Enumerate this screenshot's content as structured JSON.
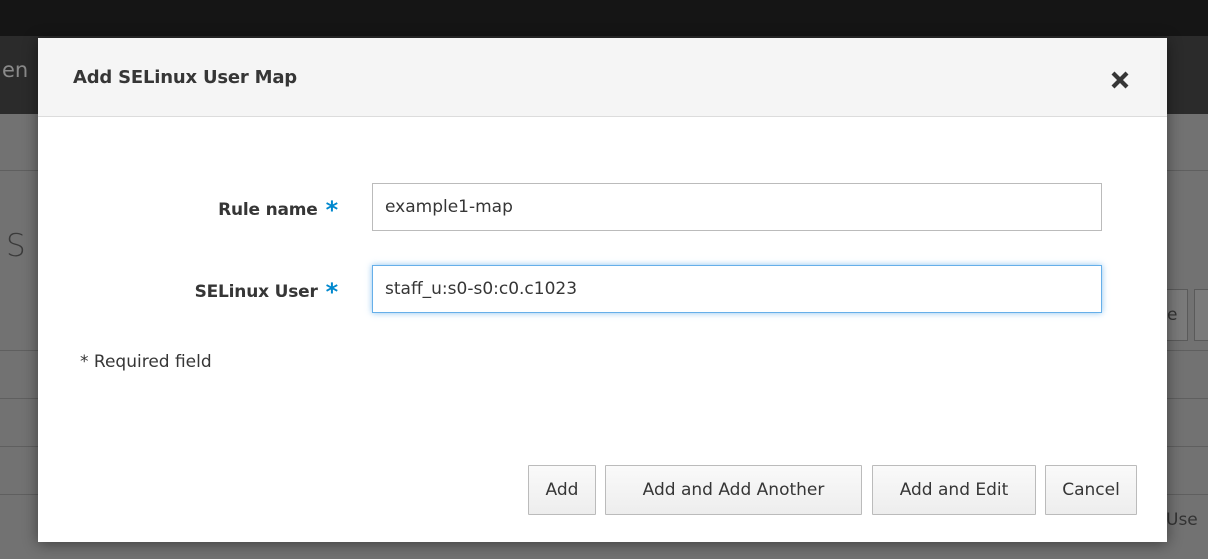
{
  "background": {
    "nav_fragment": "en",
    "heading_fragment": "S",
    "button_fragment": "e",
    "column_fragment": "Use"
  },
  "dialog": {
    "title": "Add SELinux User Map",
    "close_icon": "close-icon",
    "fields": {
      "rule_name": {
        "label": "Rule name",
        "value": "example1-map",
        "required_mark": "*"
      },
      "selinux_user": {
        "label": "SELinux User",
        "value": "staff_u:s0-s0:c0.c1023",
        "required_mark": "*"
      }
    },
    "required_note": "* Required field",
    "buttons": {
      "add": "Add",
      "add_another": "Add and Add Another",
      "add_edit": "Add and Edit",
      "cancel": "Cancel"
    }
  },
  "colors": {
    "required_star": "#0088ce",
    "focus_border": "#66afe9",
    "header_bg": "#f5f5f5"
  }
}
